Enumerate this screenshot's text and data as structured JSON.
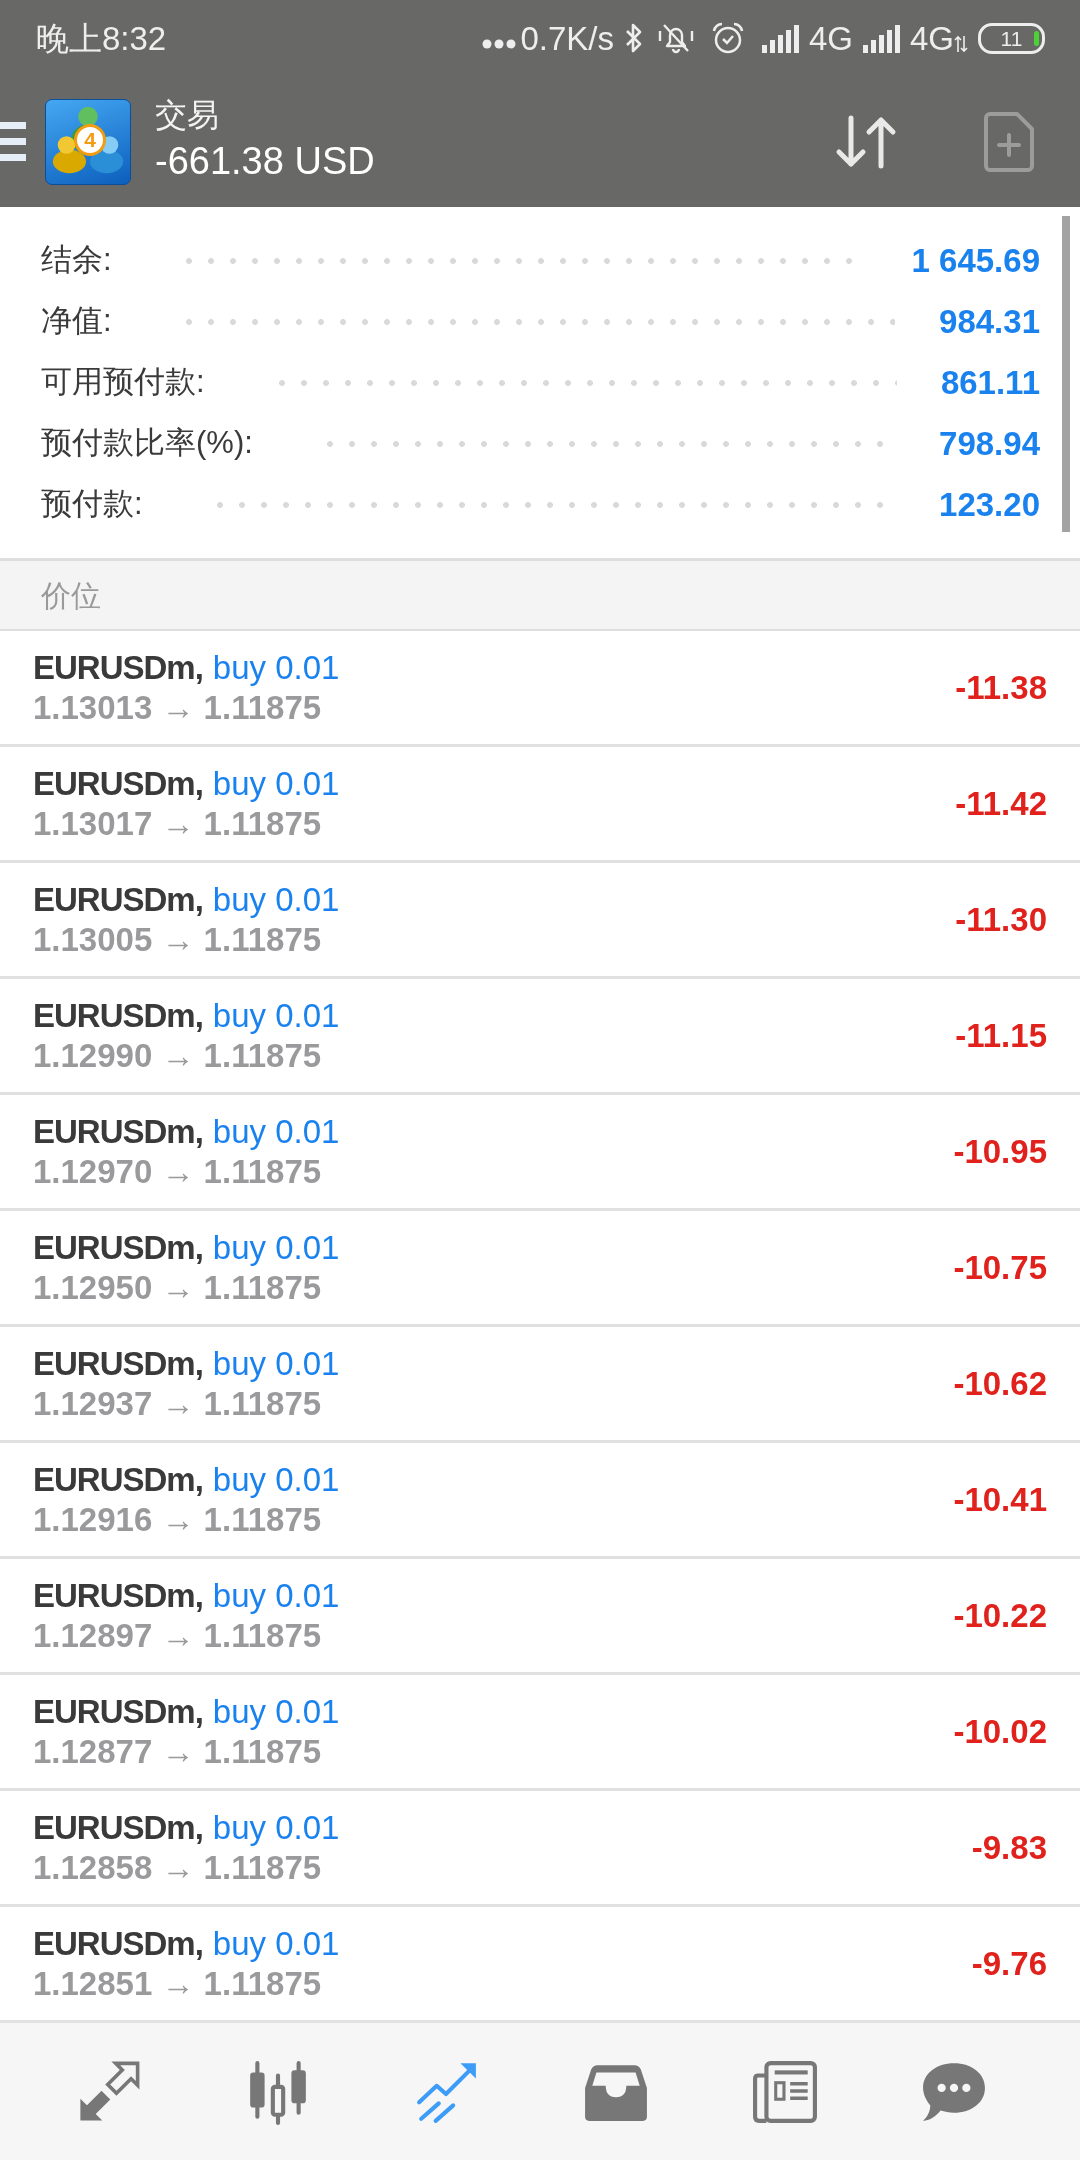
{
  "status_bar": {
    "time": "晚上8:32",
    "network_speed": "0.7K/s",
    "networks": [
      "4G",
      "4G"
    ],
    "battery": "11"
  },
  "header": {
    "logo_number": "4",
    "title": "交易",
    "balance": "-661.38 USD",
    "actions": [
      {
        "kind": "sort",
        "disabled": false
      },
      {
        "kind": "new_order",
        "disabled": true
      }
    ]
  },
  "account_summary": [
    {
      "label": "结余:",
      "value": "1 645.69"
    },
    {
      "label": "净值:",
      "value": "984.31"
    },
    {
      "label": "可用预付款:",
      "value": "861.11"
    },
    {
      "label": "预付款比率(%):",
      "value": "798.94"
    },
    {
      "label": "预付款:",
      "value": "123.20"
    }
  ],
  "section_title": "价位",
  "positions": [
    {
      "symbol": "EURUSDm,",
      "order": "buy 0.01",
      "prices": "1.13013 → 1.11875",
      "profit": "-11.38"
    },
    {
      "symbol": "EURUSDm,",
      "order": "buy 0.01",
      "prices": "1.13017 → 1.11875",
      "profit": "-11.42"
    },
    {
      "symbol": "EURUSDm,",
      "order": "buy 0.01",
      "prices": "1.13005 → 1.11875",
      "profit": "-11.30"
    },
    {
      "symbol": "EURUSDm,",
      "order": "buy 0.01",
      "prices": "1.12990 → 1.11875",
      "profit": "-11.15"
    },
    {
      "symbol": "EURUSDm,",
      "order": "buy 0.01",
      "prices": "1.12970 → 1.11875",
      "profit": "-10.95"
    },
    {
      "symbol": "EURUSDm,",
      "order": "buy 0.01",
      "prices": "1.12950 → 1.11875",
      "profit": "-10.75"
    },
    {
      "symbol": "EURUSDm,",
      "order": "buy 0.01",
      "prices": "1.12937 → 1.11875",
      "profit": "-10.62"
    },
    {
      "symbol": "EURUSDm,",
      "order": "buy 0.01",
      "prices": "1.12916 → 1.11875",
      "profit": "-10.41"
    },
    {
      "symbol": "EURUSDm,",
      "order": "buy 0.01",
      "prices": "1.12897 → 1.11875",
      "profit": "-10.22"
    },
    {
      "symbol": "EURUSDm,",
      "order": "buy 0.01",
      "prices": "1.12877 → 1.11875",
      "profit": "-10.02"
    },
    {
      "symbol": "EURUSDm,",
      "order": "buy 0.01",
      "prices": "1.12858 → 1.11875",
      "profit": "-9.83"
    },
    {
      "symbol": "EURUSDm,",
      "order": "buy 0.01",
      "prices": "1.12851 → 1.11875",
      "profit": "-9.76"
    }
  ],
  "bottom_nav": [
    {
      "kind": "quotes",
      "selected": false
    },
    {
      "kind": "chart",
      "selected": false
    },
    {
      "kind": "trade",
      "selected": true
    },
    {
      "kind": "history",
      "selected": false
    },
    {
      "kind": "news",
      "selected": false
    },
    {
      "kind": "chat",
      "selected": false
    }
  ]
}
